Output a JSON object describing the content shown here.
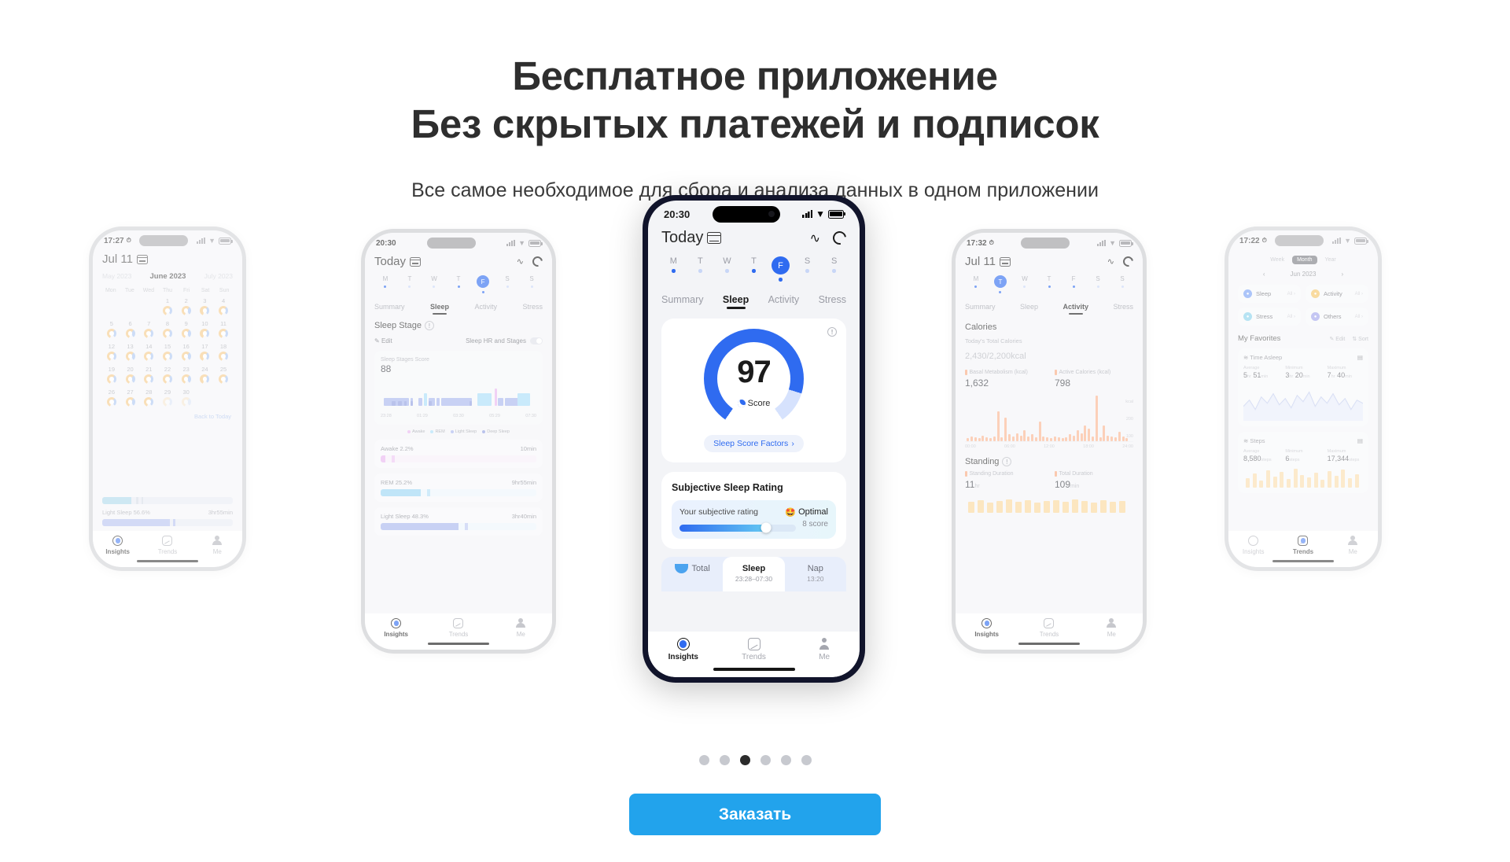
{
  "hero": {
    "title_line1": "Бесплатное приложение",
    "title_line2": "Без скрытых платежей и подписок",
    "subtitle": "Все самое необходимое для сбора и анализа данных  в одном приложении"
  },
  "cta": {
    "label": "Заказать"
  },
  "carousel": {
    "dots": 6,
    "active_index": 2
  },
  "colors": {
    "accent_blue": "#2f6bf0",
    "cta_blue": "#22a3ec",
    "orange": "#f7a97f",
    "ring_gold": "#f5c173",
    "light_sleep": "#9dbdf0"
  },
  "nav": {
    "items": [
      {
        "label": "Insights",
        "icon": "target-icon",
        "active": true
      },
      {
        "label": "Trends",
        "icon": "chart-square-icon",
        "active": false
      },
      {
        "label": "Me",
        "icon": "person-icon",
        "active": false
      }
    ]
  },
  "phone1": {
    "status": {
      "time": "17:27",
      "alarm_icon": "alarm-icon",
      "signal_icon": "signal-icon",
      "wifi_icon": "wifi-icon",
      "battery_icon": "battery-icon"
    },
    "title": "Jul 11",
    "calendar_icon": "calendar-icon",
    "months": {
      "prev": "May 2023",
      "current": "June 2023",
      "next": "July 2023"
    },
    "dow": [
      "Mon",
      "Tue",
      "Wed",
      "Thu",
      "Fri",
      "Sat",
      "Sun"
    ],
    "lead_blanks": 3,
    "days": [
      1,
      2,
      3,
      4,
      5,
      6,
      7,
      8,
      9,
      10,
      11,
      12,
      13,
      14,
      15,
      16,
      17,
      18,
      19,
      20,
      21,
      22,
      23,
      24,
      25,
      26,
      27,
      28,
      29,
      30
    ],
    "back_to_today": "Back to Today",
    "stat": {
      "label": "Light Sleep 56.6%",
      "value": "3hr55min"
    }
  },
  "phone2": {
    "status": {
      "time": "20:30"
    },
    "title": "Today",
    "weekdays": [
      "M",
      "T",
      "W",
      "T",
      "F",
      "S",
      "S"
    ],
    "active_weekday_index": 4,
    "tabs": [
      {
        "label": "Summary",
        "active": false
      },
      {
        "label": "Sleep",
        "active": true
      },
      {
        "label": "Activity",
        "active": false
      },
      {
        "label": "Stress",
        "active": false
      }
    ],
    "section_title": "Sleep Stage",
    "edit_label": "Edit",
    "toggle_label": "Sleep HR and Stages",
    "score_label": "Sleep Stages Score",
    "score_value": "88",
    "axis": [
      "23:28",
      "01:29",
      "03:30",
      "05:29",
      "07:30"
    ],
    "legend": [
      "Awake",
      "REM",
      "Light Sleep",
      "Deep Sleep"
    ],
    "stages": [
      {
        "label": "Awake 2.2%",
        "duration": "10min",
        "pct": 3
      },
      {
        "label": "REM 25.2%",
        "duration": "9hr55min",
        "pct": 26
      },
      {
        "label": "Light Sleep 48.3%",
        "duration": "3hr40min",
        "pct": 50
      }
    ]
  },
  "phone3": {
    "status": {
      "time": "20:30",
      "signal_icon": "signal-icon",
      "wifi_icon": "wifi-icon",
      "battery_icon": "battery-icon"
    },
    "title": "Today",
    "calendar_icon": "calendar-icon",
    "top_icons": [
      "pulse-icon",
      "sync-icon"
    ],
    "weekdays": [
      "M",
      "T",
      "W",
      "T",
      "F",
      "S",
      "S"
    ],
    "active_weekday_index": 4,
    "tabs": [
      {
        "label": "Summary",
        "active": false
      },
      {
        "label": "Sleep",
        "active": true
      },
      {
        "label": "Activity",
        "active": false
      },
      {
        "label": "Stress",
        "active": false
      }
    ],
    "gauge": {
      "value": "97",
      "label": "Score",
      "icon": "moon-z-icon",
      "percent": 97
    },
    "factors_button": "Sleep Score Factors",
    "info_icon": "info-icon",
    "rating": {
      "title": "Subjective Sleep Rating",
      "row_label": "Your subjective rating",
      "verdict": "Optimal",
      "verdict_emoji": "🤩",
      "score_text": "8 score",
      "slider_percent": 74
    },
    "segments": [
      {
        "label": "Total",
        "sub": "",
        "icon": "wave-icon",
        "active": false
      },
      {
        "label": "Sleep",
        "sub": "23:28–07:30",
        "active": true
      },
      {
        "label": "Nap",
        "sub": "13:20",
        "active": false
      }
    ]
  },
  "phone4": {
    "status": {
      "time": "17:32"
    },
    "title": "Jul 11",
    "weekdays": [
      "M",
      "T",
      "W",
      "T",
      "F",
      "S",
      "S"
    ],
    "active_weekday_index": 1,
    "tabs": [
      {
        "label": "Summary",
        "active": false
      },
      {
        "label": "Sleep",
        "active": false
      },
      {
        "label": "Activity",
        "active": true
      },
      {
        "label": "Stress",
        "active": false
      }
    ],
    "calories": {
      "title": "Calories",
      "total_label": "Today's Total Calories",
      "total_value": "2,430",
      "total_goal": "/2,200kcal",
      "basal_label": "Basal Metabolism (kcal)",
      "basal_value": "1,632",
      "active_label": "Active Calories (kcal)",
      "active_value": "798",
      "y_unit": "kcal",
      "y_ticks": [
        "200",
        "100"
      ],
      "x_ticks": [
        "00:00",
        "06:00",
        "12:00",
        "18:00",
        "24:00"
      ]
    },
    "standing": {
      "title": "Standing",
      "duration_label": "Standing Duration",
      "duration_value": "11",
      "duration_unit": "hr",
      "total_label": "Total Duration",
      "total_value": "109",
      "total_unit": "min"
    }
  },
  "phone5": {
    "status": {
      "time": "17:22"
    },
    "range_tabs": [
      {
        "label": "Week",
        "active": false
      },
      {
        "label": "Month",
        "active": true
      },
      {
        "label": "Year",
        "active": false
      }
    ],
    "month": "Jun 2023",
    "categories": [
      {
        "label": "Sleep",
        "icon": "moon-icon",
        "color": "#5b8df5",
        "more": "All"
      },
      {
        "label": "Activity",
        "icon": "flame-icon",
        "color": "#f5b944",
        "more": "All"
      },
      {
        "label": "Stress",
        "icon": "heart-icon",
        "color": "#6fc9e8",
        "more": "All"
      },
      {
        "label": "Others",
        "icon": "grid-icon",
        "color": "#8b8fe8",
        "more": "All"
      }
    ],
    "favorites": {
      "title": "My Favorites",
      "edit": "Edit",
      "sort": "Sort",
      "cards": [
        {
          "name": "Time Asleep",
          "stats": [
            {
              "k": "Average",
              "v": "5",
              "u": "hr",
              "v2": "51",
              "u2": "min"
            },
            {
              "k": "Minimum",
              "v": "3",
              "u": "hr",
              "v2": "20",
              "u2": "min"
            },
            {
              "k": "Maximum",
              "v": "7",
              "u": "hr",
              "v2": "40",
              "u2": "min"
            }
          ]
        },
        {
          "name": "Steps",
          "stats": [
            {
              "k": "Average",
              "v": "8,580",
              "u": "steps"
            },
            {
              "k": "Minimum",
              "v": "6",
              "u": "steps"
            },
            {
              "k": "Maximum",
              "v": "17,344",
              "u": "steps"
            }
          ]
        }
      ]
    }
  }
}
